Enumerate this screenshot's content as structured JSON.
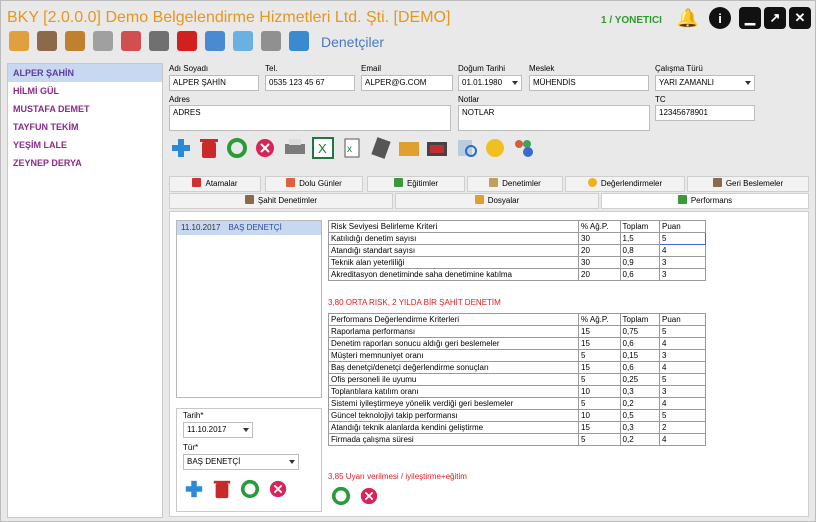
{
  "app": {
    "title": "BKY [2.0.0.0] Demo Belgelendirme Hizmetleri Ltd. Şti. [DEMO]",
    "user": "1 / YONETICI",
    "module": "Denetçiler"
  },
  "sidebar": {
    "items": [
      "ALPER ŞAHİN",
      "HİLMİ GÜL",
      "MUSTAFA DEMET",
      "TAYFUN TEKİM",
      "YEŞİM LALE",
      "ZEYNEP DERYA"
    ]
  },
  "form": {
    "name_label": "Adı Soyadı",
    "name": "ALPER ŞAHİN",
    "tel_label": "Tel.",
    "tel": "0535 123 45 67",
    "email_label": "Email",
    "email": "ALPER@G.COM",
    "dob_label": "Doğum Tarihi",
    "dob": "01.01.1980",
    "job_label": "Meslek",
    "job": "MÜHENDİS",
    "work_label": "Çalışma Türü",
    "work": "YARI ZAMANLI",
    "addr_label": "Adres",
    "addr": "ADRES",
    "notes_label": "Notlar",
    "notes": "NOTLAR",
    "tc_label": "TC",
    "tc": "12345678901"
  },
  "tabs": {
    "row1": [
      "Atamalar",
      "Dolu Günler",
      "Eğitimler",
      "Denetimler",
      "Değerlendirmeler",
      "Geri Beslemeler"
    ],
    "row2": [
      "Şahit Denetimler",
      "Dosyalar",
      "Performans"
    ]
  },
  "perf": {
    "list_date": "11.10.2017",
    "list_role": "BAŞ DENETÇİ",
    "date_label": "Tarih*",
    "date": "11.10.2017",
    "type_label": "Tür*",
    "type": "BAŞ DENETÇİ",
    "risk_summary": "3,80 ORTA RISK, 2 YILDA BİR ŞAHİT DENETİM",
    "perf_summary": "3,85 Uyarı verilmesi / iyileştirme+eğitim"
  },
  "risk_table": {
    "headers": [
      "Risk Seviyesi Belirleme Kriteri",
      "% Ağ.P.",
      "Toplam",
      "Puan"
    ],
    "rows": [
      [
        "Katılıdığı denetim sayısı",
        "30",
        "1,5",
        "5"
      ],
      [
        "Atandığı standart sayısı",
        "20",
        "0,8",
        "4"
      ],
      [
        "Teknik alan yeterliliği",
        "30",
        "0,9",
        "3"
      ],
      [
        "Akreditasyon denetiminde saha denetimine katılma",
        "20",
        "0,6",
        "3"
      ]
    ]
  },
  "perf_table": {
    "headers": [
      "Performans Değerlendirme Kriterleri",
      "% Ağ.P.",
      "Toplam",
      "Puan"
    ],
    "rows": [
      [
        "Raporlama performansı",
        "15",
        "0,75",
        "5"
      ],
      [
        "Denetim raporları sonucu aldığı geri beslemeler",
        "15",
        "0,6",
        "4"
      ],
      [
        "Müşteri memnuniyet oranı",
        "5",
        "0,15",
        "3"
      ],
      [
        "Baş denetçi/denetçi değerlendirme sonuçları",
        "15",
        "0,6",
        "4"
      ],
      [
        "Ofis personeli ile uyumu",
        "5",
        "0,25",
        "5"
      ],
      [
        "Toplantılara katılım oranı",
        "10",
        "0,3",
        "3"
      ],
      [
        "Sistemi iyileştirmeye yönelik verdiği geri beslemeler",
        "5",
        "0,2",
        "4"
      ],
      [
        "Güncel teknolojiyi takip performansı",
        "10",
        "0,5",
        "5"
      ],
      [
        "Atandığı teknik alanlarda kendini geliştirme",
        "15",
        "0,3",
        "2"
      ],
      [
        "Firmada çalışma süresi",
        "5",
        "0,2",
        "4"
      ]
    ]
  },
  "colors": {
    "title": "#e8961c",
    "user": "#2e9a2e",
    "module": "#4a78c2",
    "sidebar_text": "#8b2b8b",
    "summary": "#e02020"
  }
}
